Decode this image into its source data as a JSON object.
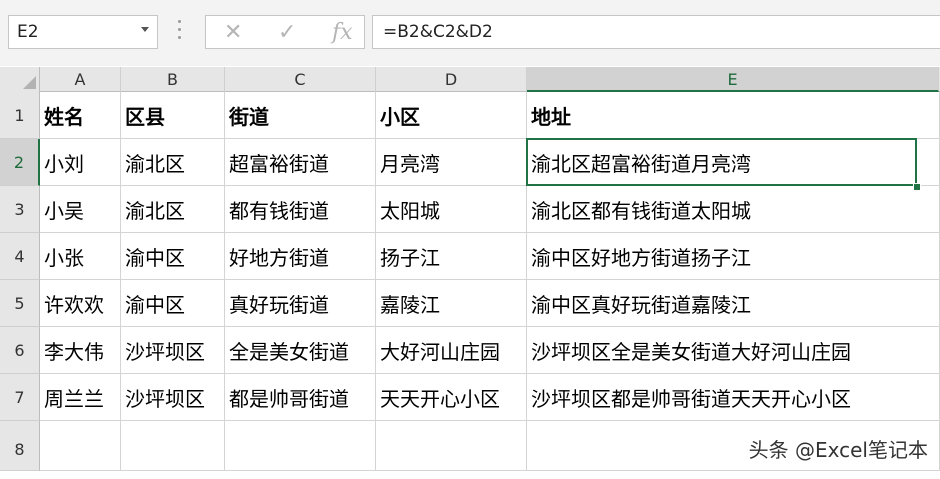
{
  "formula_bar": {
    "name_box": "E2",
    "cancel_glyph": "✕",
    "enter_glyph": "✓",
    "fx_label": "fx",
    "formula": "=B2&C2&D2"
  },
  "columns": [
    "A",
    "B",
    "C",
    "D",
    "E"
  ],
  "selected_column": "E",
  "rows": [
    "1",
    "2",
    "3",
    "4",
    "5",
    "6",
    "7",
    "8"
  ],
  "selected_row": "2",
  "cells": [
    [
      "姓名",
      "区县",
      "街道",
      "小区",
      "地址"
    ],
    [
      "小刘",
      "渝北区",
      "超富裕街道",
      "月亮湾",
      "渝北区超富裕街道月亮湾"
    ],
    [
      "小吴",
      "渝北区",
      "都有钱街道",
      "太阳城",
      "渝北区都有钱街道太阳城"
    ],
    [
      "小张",
      "渝中区",
      "好地方街道",
      "扬子江",
      "渝中区好地方街道扬子江"
    ],
    [
      "许欢欢",
      "渝中区",
      "真好玩街道",
      "嘉陵江",
      "渝中区真好玩街道嘉陵江"
    ],
    [
      "李大伟",
      "沙坪坝区",
      "全是美女街道",
      "大好河山庄园",
      "沙坪坝区全是美女街道大好河山庄园"
    ],
    [
      "周兰兰",
      "沙坪坝区",
      "都是帅哥街道",
      "天天开心小区",
      "沙坪坝区都是帅哥街道天天开心小区"
    ],
    [
      "",
      "",
      "",
      "",
      ""
    ]
  ],
  "watermark": "头条 @Excel笔记本",
  "colors": {
    "accent": "#217346"
  }
}
